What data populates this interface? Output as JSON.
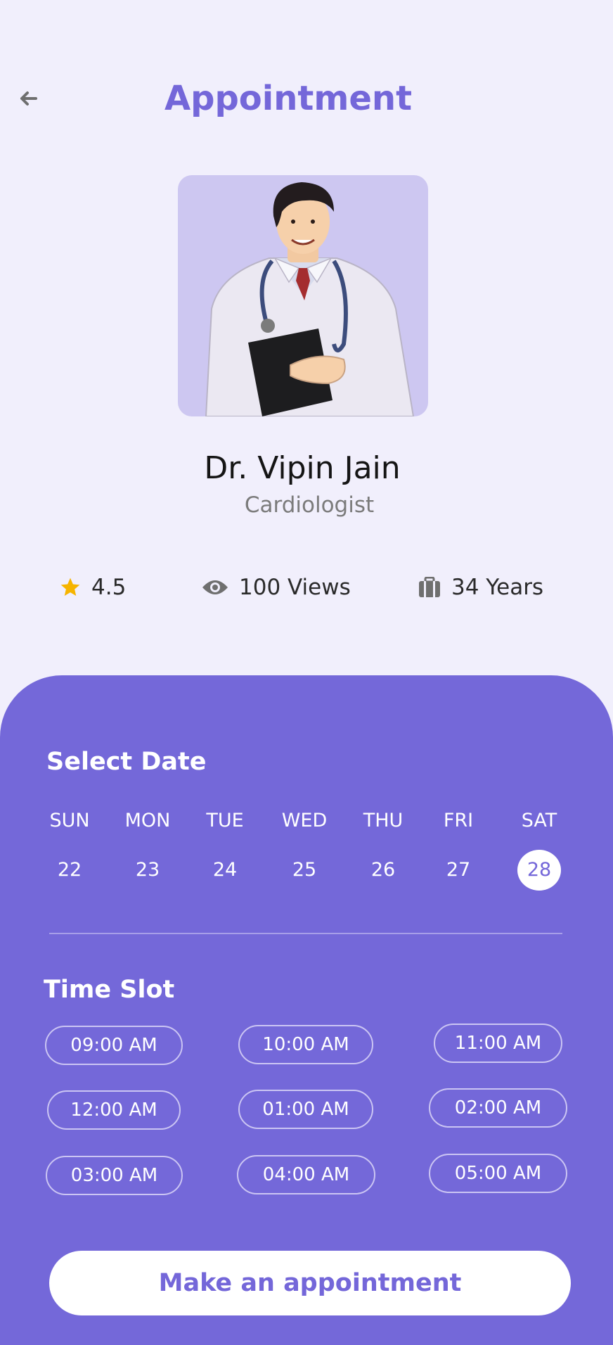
{
  "header": {
    "title": "Appointment"
  },
  "doctor": {
    "name": "Dr. Vipin Jain",
    "specialty": "Cardiologist"
  },
  "stats": {
    "rating": "4.5",
    "views": "100 Views",
    "experience": "34 Years"
  },
  "colors": {
    "accent": "#7467d9",
    "panel": "#7468d9",
    "background": "#f1effc",
    "star": "#f6b400"
  },
  "icons": {
    "back": "arrow-left-icon",
    "rating": "star-icon",
    "views": "eye-icon",
    "experience": "briefcase-icon"
  },
  "schedule": {
    "date_title": "Select Date",
    "days": [
      {
        "name": "SUN",
        "num": "22"
      },
      {
        "name": "MON",
        "num": "23"
      },
      {
        "name": "TUE",
        "num": "24"
      },
      {
        "name": "WED",
        "num": "25"
      },
      {
        "name": "THU",
        "num": "26"
      },
      {
        "name": "FRI",
        "num": "27"
      },
      {
        "name": "SAT",
        "num": "28",
        "selected": true
      }
    ],
    "slot_title": "Time Slot",
    "slots": [
      "09:00 AM",
      "10:00 AM",
      "11:00 AM",
      "12:00 AM",
      "01:00 AM",
      "02:00 AM",
      "03:00 AM",
      "04:00 AM",
      "05:00 AM"
    ]
  },
  "cta": {
    "label": "Make an appointment"
  }
}
